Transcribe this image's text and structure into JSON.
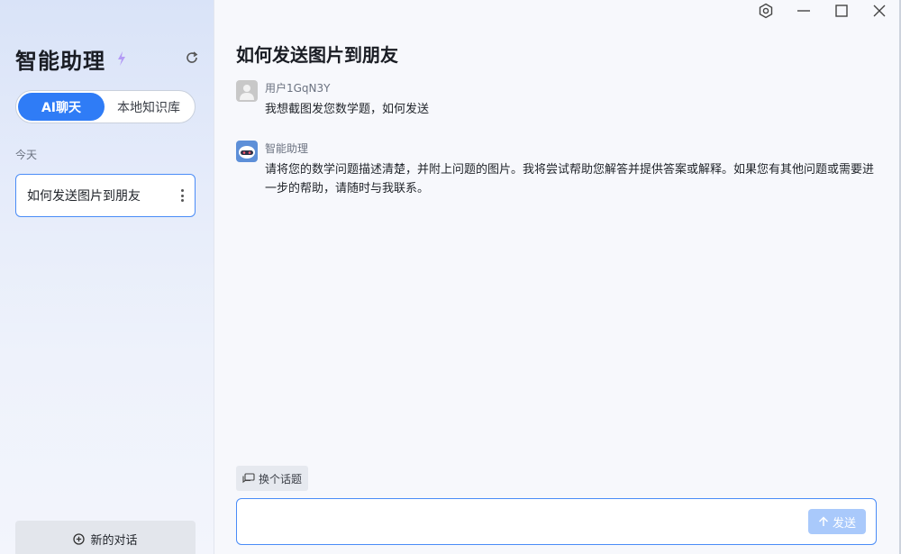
{
  "sidebar": {
    "app_title": "智能助理",
    "icons": {
      "title_badge": "sparkle-icon",
      "refresh": "refresh-icon"
    },
    "tabs": [
      {
        "label": "AI聊天",
        "active": true
      },
      {
        "label": "本地知识库",
        "active": false
      }
    ],
    "section_label": "今天",
    "conversations": [
      {
        "title": "如何发送图片到朋友",
        "selected": true
      }
    ],
    "new_chat_label": "新的对话"
  },
  "window_controls": [
    "settings-icon",
    "minimize-icon",
    "maximize-icon",
    "close-icon"
  ],
  "main": {
    "title": "如何发送图片到朋友",
    "messages": [
      {
        "role": "user",
        "sender": "用户1GqN3Y",
        "text": "我想截图发您数学题，如何发送"
      },
      {
        "role": "assistant",
        "sender": "智能助理",
        "text": "请将您的数学问题描述清楚，并附上问题的图片。我将尝试帮助您解答并提供答案或解释。如果您有其他问题或需要进一步的帮助，请随时与我联系。"
      }
    ],
    "change_topic_label": "换个话题",
    "input": {
      "value": "",
      "placeholder": ""
    },
    "send_label": "发送",
    "footer_note": ""
  },
  "colors": {
    "accent": "#2f7cf6",
    "send_disabled": "#a9c9fb",
    "sidebar_top": "#d9e3f8"
  }
}
